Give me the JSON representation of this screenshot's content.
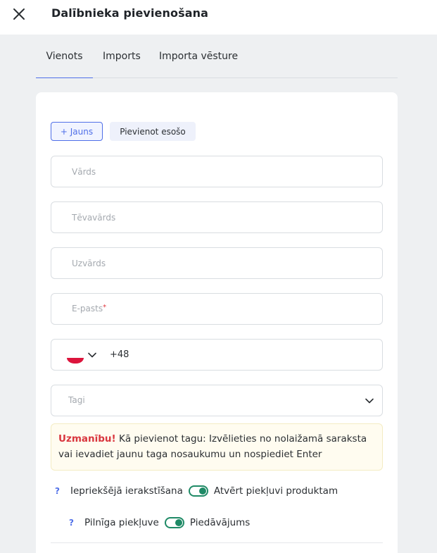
{
  "header": {
    "title": "Dalībnieka pievienošana"
  },
  "tabs": [
    {
      "label": "Vienots",
      "active": true
    },
    {
      "label": "Imports",
      "active": false
    },
    {
      "label": "Importa vēsture",
      "active": false
    }
  ],
  "mode_buttons": {
    "new_label": "+ Jauns",
    "existing_label": "Pievienot esošo"
  },
  "form": {
    "first_name": {
      "placeholder": "Vārds",
      "value": ""
    },
    "patronymic": {
      "placeholder": "Tēvavārds",
      "value": ""
    },
    "last_name": {
      "placeholder": "Uzvārds",
      "value": ""
    },
    "email": {
      "label": "E-pasts",
      "required_mark": "*",
      "value": ""
    },
    "phone": {
      "country_flag": "poland-flag-icon",
      "value": "+48"
    },
    "tags": {
      "placeholder": "Tagi"
    }
  },
  "warning": {
    "title": "Uzmanību!",
    "text": " Kā pievienot tagu: Izvēlieties no nolaižamā saraksta vai ievadiet jaunu taga nosaukumu un nospiediet Enter"
  },
  "toggles": [
    {
      "help": "?",
      "left_label": "Iepriekšējā ierakstīšana",
      "right_label": "Atvērt piekļuvi produktam",
      "state": "right"
    },
    {
      "help": "?",
      "left_label": "Pilnīga piekļuve",
      "right_label": "Piedāvājums",
      "state": "right"
    }
  ],
  "colors": {
    "accent": "#4f6fe8",
    "toggle": "#1f8a66",
    "warning_title": "#d9363e",
    "background": "#eef0f2"
  }
}
